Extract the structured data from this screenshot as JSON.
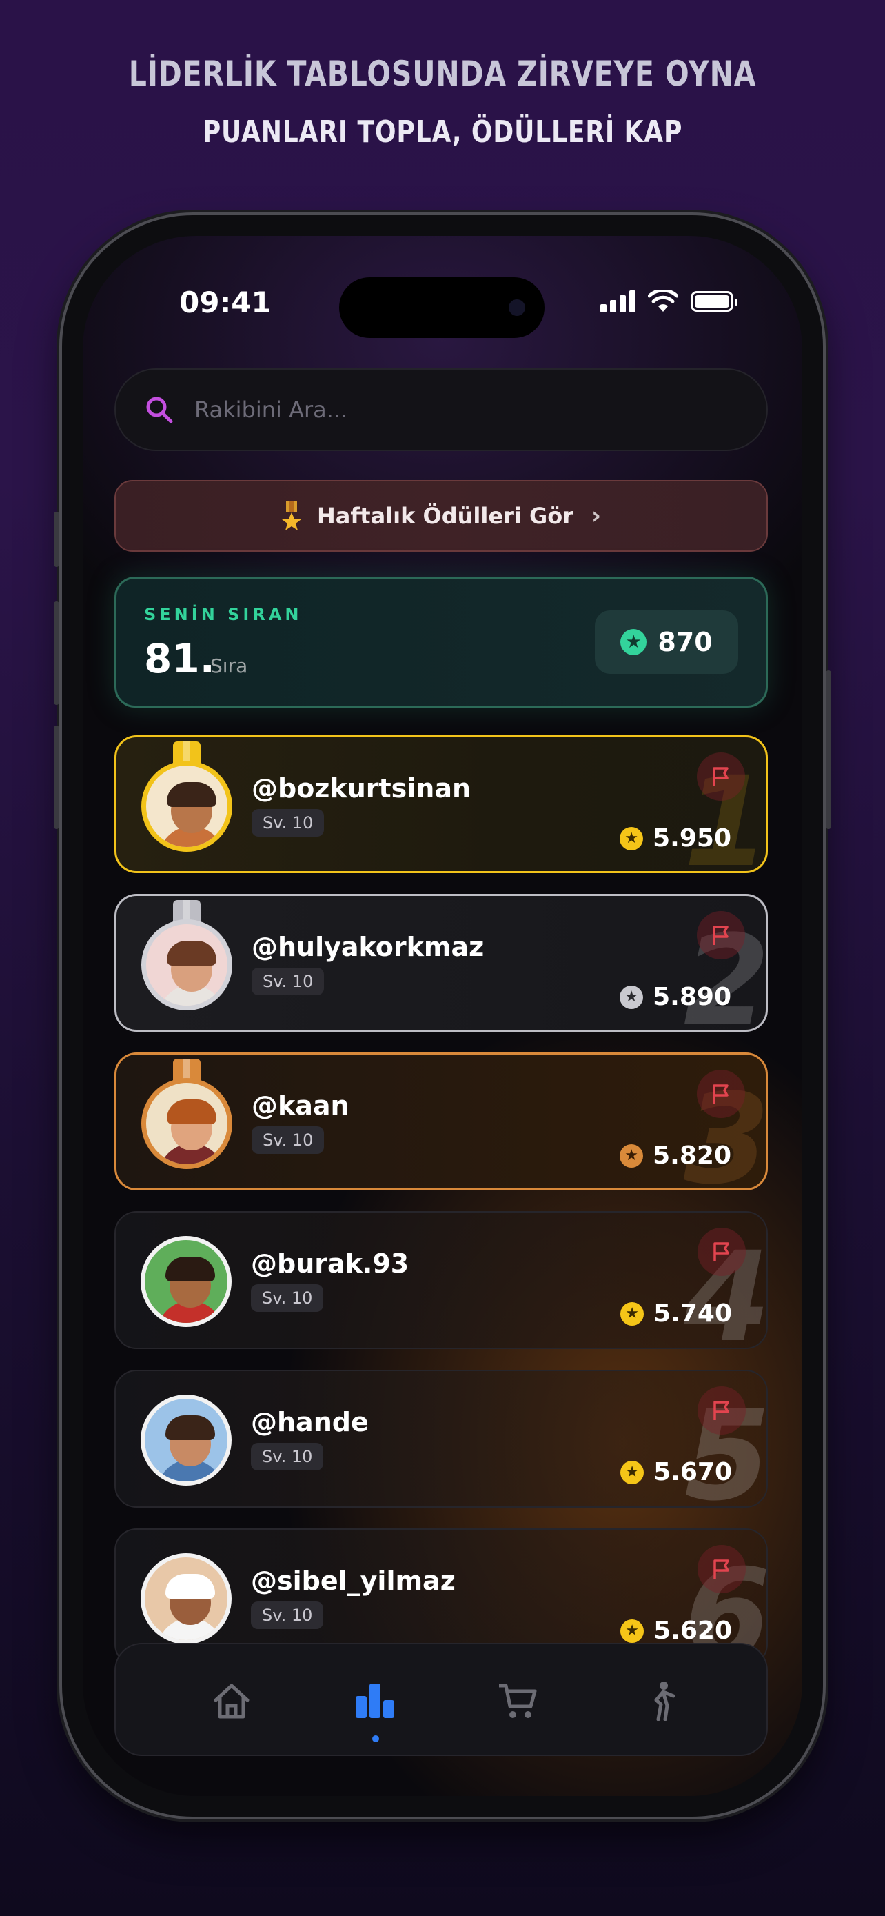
{
  "header": {
    "line1": "LİDERLİK TABLOSUNDA ZİRVEYE OYNA",
    "line2": "PUANLARI TOPLA, ÖDÜLLERİ KAP"
  },
  "status_bar": {
    "time": "09:41"
  },
  "search": {
    "placeholder": "Rakibini Ara...",
    "value": ""
  },
  "rewards_banner": {
    "label": "Haftalık Ödülleri Gör"
  },
  "my_rank": {
    "label": "SENİN SIRAN",
    "rank": "81.",
    "rank_suffix": "Sıra",
    "points": "870"
  },
  "leaderboard": [
    {
      "rank": "1",
      "username": "@bozkurtsinan",
      "level": "Sv. 10",
      "score": "5.950",
      "tier": "gold"
    },
    {
      "rank": "2",
      "username": "@hulyakorkmaz",
      "level": "Sv. 10",
      "score": "5.890",
      "tier": "silver"
    },
    {
      "rank": "3",
      "username": "@kaan",
      "level": "Sv. 10",
      "score": "5.820",
      "tier": "bronze"
    },
    {
      "rank": "4",
      "username": "@burak.93",
      "level": "Sv. 10",
      "score": "5.740",
      "tier": "none"
    },
    {
      "rank": "5",
      "username": "@hande",
      "level": "Sv. 10",
      "score": "5.670",
      "tier": "none"
    },
    {
      "rank": "6",
      "username": "@sibel_yilmaz",
      "level": "Sv. 10",
      "score": "5.620",
      "tier": "none"
    }
  ],
  "tabbar": {
    "items": [
      {
        "icon": "home-icon",
        "active": false
      },
      {
        "icon": "leaderboard-icon",
        "active": true
      },
      {
        "icon": "cart-icon",
        "active": false
      },
      {
        "icon": "person-icon",
        "active": false
      }
    ],
    "active_color": "#2f7cf6"
  },
  "colors": {
    "gold": "#f5c518",
    "silver": "#c9c9cf",
    "bronze": "#d98a3a",
    "accent_green": "#33d39b",
    "flag_red": "#e2444f"
  }
}
